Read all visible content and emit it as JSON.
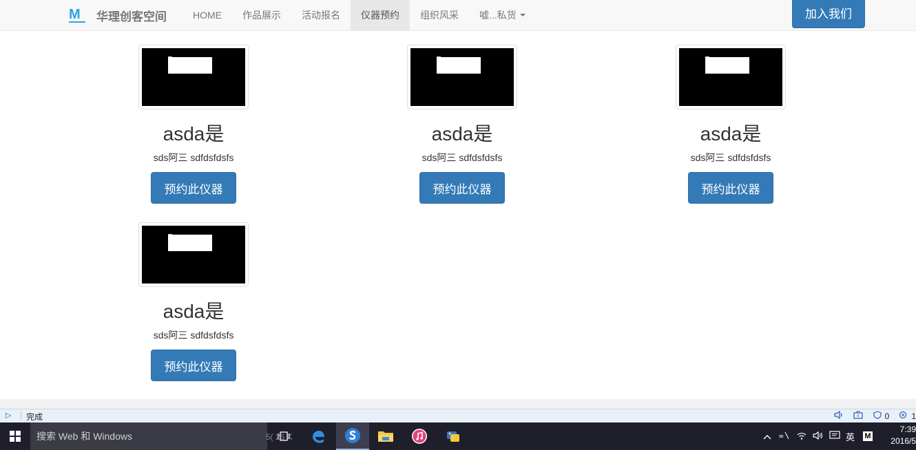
{
  "navbar": {
    "brand_name": "华理创客空间",
    "logo_letter": "M",
    "items": [
      {
        "label": "HOME"
      },
      {
        "label": "作品展示"
      },
      {
        "label": "活动报名"
      },
      {
        "label": "仪器预约",
        "active": true
      },
      {
        "label": "组织风采"
      },
      {
        "label": "嘘...私货",
        "dropdown": true
      }
    ],
    "join_button": "加入我们"
  },
  "cards": [
    {
      "title": "asda是",
      "description": "sds阿三 sdfdsfdsfs",
      "button": "预约此仪器"
    },
    {
      "title": "asda是",
      "description": "sds阿三 sdfdsfdsfs",
      "button": "预约此仪器"
    },
    {
      "title": "asda是",
      "description": "sds阿三 sdfdsfdsfs",
      "button": "预约此仪器"
    },
    {
      "title": "asda是",
      "description": "sds阿三 sdfdsfdsfs",
      "button": "预约此仪器"
    }
  ],
  "statusbar": {
    "status_text": "完成",
    "blocked_count": "0",
    "zoom_label": "1"
  },
  "taskbar": {
    "search_placeholder": "搜索 Web 和 Windows",
    "ime_label": "英",
    "clock_time": "7:39",
    "clock_date": "2016/5",
    "hidden_text": "5(  26 K"
  },
  "colors": {
    "primary": "#337ab7",
    "navbar_bg": "#f8f8f8",
    "taskbar_bg": "#1e1f2b",
    "statusbar_bg": "#e8f1fa"
  }
}
